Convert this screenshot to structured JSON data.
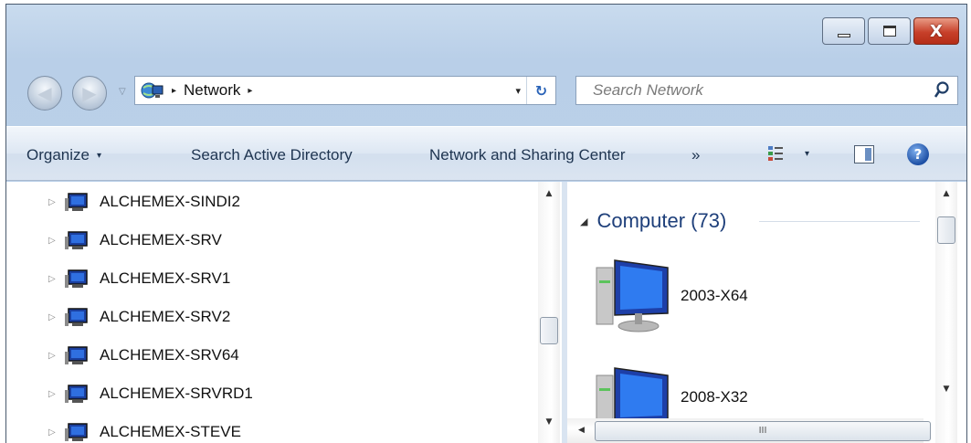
{
  "window": {
    "controls": {
      "minimize": "minimize",
      "maximize": "maximize",
      "close": "X"
    }
  },
  "address": {
    "crumbs": [
      "Network"
    ],
    "separator": "▸",
    "dropdown": "▾",
    "refresh": "↻"
  },
  "search": {
    "placeholder": "Search Network"
  },
  "toolbar": {
    "organize": "Organize",
    "search_ad": "Search Active Directory",
    "network_sharing": "Network and Sharing Center",
    "more": "»",
    "caret": "▾",
    "help": "?"
  },
  "tree": {
    "items": [
      {
        "label": "ALCHEMEX-SINDI2"
      },
      {
        "label": "ALCHEMEX-SRV"
      },
      {
        "label": "ALCHEMEX-SRV1"
      },
      {
        "label": "ALCHEMEX-SRV2"
      },
      {
        "label": "ALCHEMEX-SRV64"
      },
      {
        "label": "ALCHEMEX-SRVRD1"
      },
      {
        "label": "ALCHEMEX-STEVE"
      }
    ],
    "expander": "▷"
  },
  "content": {
    "group_title": "Computer (73)",
    "group_caret": "◢",
    "computers": [
      {
        "name": "2003-X64"
      },
      {
        "name": "2008-X32"
      }
    ],
    "hscroll_grip": "III"
  },
  "colors": {
    "accent": "#1e3f7a",
    "close_button": "#c7402a",
    "chrome": "#bcd2ea"
  }
}
